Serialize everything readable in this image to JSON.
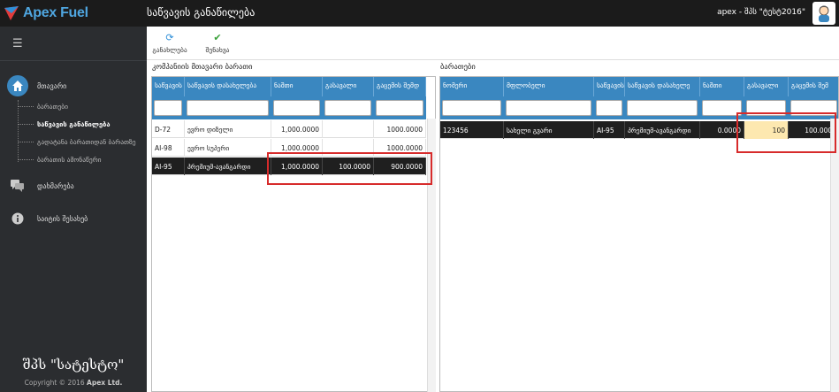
{
  "app": {
    "name": "Apex Fuel",
    "page_title": "საწვავის განაწილება",
    "user": "apex - შპს \"ტესტ2016\""
  },
  "sidebar": {
    "main_label": "მთავარი",
    "sub_items": [
      "ბარათები",
      "საწვავის განაწილება",
      "გადატანა ბარათიდან ბარათზე",
      "ბარათის ამონაწერი"
    ],
    "help_label": "დახმარება",
    "about_label": "საიტის შესახებ",
    "company": "შპს \"სატესტო\"",
    "copyright_prefix": "Copyright © 2016",
    "copyright_company": "Apex Ltd."
  },
  "toolbar": {
    "refresh_label": "განახლება",
    "save_label": "შენახვა"
  },
  "left_panel": {
    "title": "კომპანიის მთავარი ბარათი",
    "columns": [
      "საწვავის",
      "საწვავის დასახელება",
      "ნაშთი",
      "გასავალი",
      "გაცემის შემდ"
    ],
    "rows": [
      [
        "D-72",
        "ევრო დიზელი",
        "1,000.0000",
        "",
        "1000.0000"
      ],
      [
        "AI-98",
        "ევრო სუპერი",
        "1,000.0000",
        "",
        "1000.0000"
      ],
      [
        "AI-95",
        "პრემიუმ-ავანგარდი",
        "1,000.0000",
        "100.0000",
        "900.0000"
      ]
    ]
  },
  "right_panel": {
    "title": "ბარათები",
    "columns": [
      "ნომერი",
      "მფლობელი",
      "საწვავის",
      "საწვავის დასახელე",
      "ნაშთი",
      "გასავალი",
      "გაცემის შემ"
    ],
    "rows": [
      [
        "123456",
        "სახელი გვარი",
        "AI-95",
        "პრემიუმ-ავანგარდი",
        "0.0000",
        "100",
        "100.0000"
      ]
    ]
  },
  "colors": {
    "header_blue": "#3a87c0",
    "sidebar_bg": "#2b2d30",
    "topbar_bg": "#1b1b1b",
    "highlight_red": "#d72b2b",
    "edit_yellow": "#fde8b0"
  },
  "icons": [
    "home-icon",
    "chat-icon",
    "info-icon",
    "refresh-icon",
    "check-icon",
    "hamburger-icon",
    "avatar-icon"
  ]
}
